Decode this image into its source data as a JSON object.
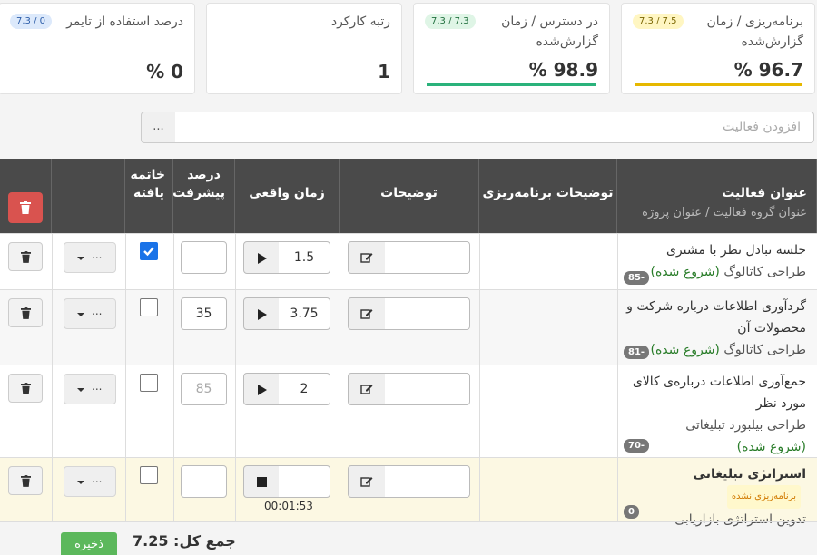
{
  "stats": [
    {
      "label": "برنامه‌ریزی / زمان گزارش‌شده",
      "badge": "7.3 / 7.5",
      "value": "96.7 %",
      "bar_color": "#e6b800",
      "badge_bg": "#fff6c2",
      "badge_fg": "#7a6500"
    },
    {
      "label": "در دسترس / زمان گزارش‌شده",
      "badge": "7.3 / 7.3",
      "value": "98.9 %",
      "bar_color": "#2ab27b",
      "badge_bg": "#dff5e6",
      "badge_fg": "#22703f"
    },
    {
      "label": "رتبه کارکرد",
      "value": "1"
    },
    {
      "label": "درصد استفاده از تایمر",
      "badge": "7.3 / 0",
      "value": "0 %",
      "badge_bg": "#dce9fb",
      "badge_fg": "#2b5ca8"
    }
  ],
  "add_activity": {
    "placeholder": "افزودن فعالیت",
    "button_label": "..."
  },
  "headers": {
    "activity_title": "عنوان فعالیت",
    "activity_sub": "عنوان گروه فعالیت  /  عنوان پروژه",
    "plan_desc": "توضیحات برنامه‌ریزی",
    "desc": "توضیحات",
    "real_time": "زمان واقعی",
    "progress": "درصد پیشرفت",
    "finished": "خاتمه یافته"
  },
  "rows": [
    {
      "title": "جلسه تبادل نظر با مشتری",
      "project": "طراحی کاتالوگ",
      "status": "(شروع شده)",
      "id": "85-",
      "time": "1.5",
      "progress": "",
      "finished": true
    },
    {
      "title": "گردآوری اطلاعات درباره شرکت و محصولات آن",
      "project": "طراحی کاتالوگ",
      "status": "(شروع شده)",
      "id": "81-",
      "time": "3.75",
      "progress": "35",
      "finished": false
    },
    {
      "title": "جمع‌آوری اطلاعات درباره‌ی کالای مورد نظر",
      "project": "طراحی بیلبورد تبلیغاتی",
      "status": "(شروع شده)",
      "id": "70-",
      "time": "2",
      "progress": "85",
      "finished": false
    },
    {
      "title": "استراتژی تبلیغاتی",
      "unplanned": "برنامه‌ریزی نشده",
      "project": "تدوین استراتژی بازاریابی",
      "id": "0",
      "time": "",
      "timer": "00:01:53",
      "progress": "",
      "finished": false
    }
  ],
  "dropdown_label": "...",
  "footer": {
    "save_label": "ذخیره",
    "total_label": "جمع کل: 7.25"
  },
  "colors": {
    "header_bg": "#4a4a4a",
    "danger": "#d9534f",
    "success": "#5cb85c",
    "active_row": "#fcf8e3"
  },
  "icons": [
    "trash-icon",
    "play-icon",
    "stop-icon",
    "edit-icon",
    "caret-down-icon",
    "checkmark-icon"
  ]
}
